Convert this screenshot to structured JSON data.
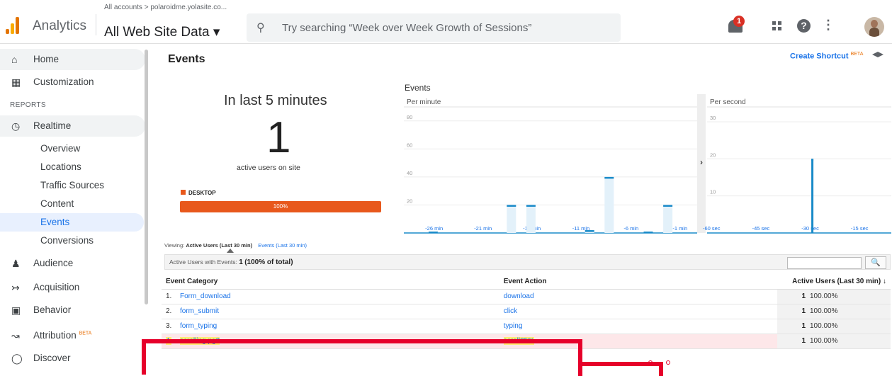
{
  "header": {
    "app_name": "Analytics",
    "breadcrumb": "All accounts > polaroidme.yolasite.co...",
    "property": "All Web Site Data ▾",
    "search_placeholder": "Try searching “Week over Week Growth of Sessions”",
    "notification_count": "1",
    "help": "?",
    "more": "⋮"
  },
  "sidebar": {
    "home": "Home",
    "customization": "Customization",
    "reports_heading": "REPORTS",
    "realtime": "Realtime",
    "realtime_items": [
      "Overview",
      "Locations",
      "Traffic Sources",
      "Content",
      "Events",
      "Conversions"
    ],
    "audience": "Audience",
    "acquisition": "Acquisition",
    "behavior": "Behavior",
    "attribution": "Attribution",
    "attribution_badge": "BETA",
    "discover": "Discover"
  },
  "page": {
    "title": "Events",
    "create_shortcut": "Create Shortcut",
    "shortcut_badge": "BETA"
  },
  "summary": {
    "headline": "In last 5 minutes",
    "active_users": "1",
    "active_label": "active users on site",
    "device": "DESKTOP",
    "device_share": "100%",
    "device_share_value": 100
  },
  "chart_data": {
    "type": "bar",
    "title": "Events",
    "panels": [
      {
        "label": "Per minute",
        "y_ticks": [
          "80",
          "60",
          "40",
          "20"
        ],
        "x_ticks": [
          "-26 min",
          "-21 min",
          "-16 min",
          "-11 min",
          "-6 min",
          "-1 min"
        ],
        "ylim": [
          0,
          90
        ],
        "x": [
          -29,
          -27,
          -25,
          -23,
          -21,
          -19,
          -17,
          -15,
          -13,
          -11,
          -9,
          -7,
          -5,
          -3,
          -1
        ],
        "values": [
          0,
          1,
          0,
          0,
          0,
          20,
          20,
          0,
          0,
          2,
          40,
          0,
          1,
          20,
          0
        ]
      },
      {
        "label": "Per second",
        "y_ticks": [
          "30",
          "20",
          "10"
        ],
        "x_ticks": [
          "-60 sec",
          "-45 sec",
          "-30 sec",
          "-15 sec"
        ],
        "ylim": [
          0,
          34
        ],
        "x": [
          -32
        ],
        "values": [
          20
        ]
      }
    ]
  },
  "viewing": {
    "label": "Viewing:",
    "active": "Active Users (Last 30 min)",
    "alt": "Events (Last 30 min)"
  },
  "table": {
    "summary_prefix": "Active Users with Events: ",
    "summary_count": "1",
    "summary_pct": "(100% of total)",
    "search_icon": "search-icon",
    "columns": [
      "Event Category",
      "Event Action",
      "Active Users (Last 30 min) ↓"
    ],
    "rows": [
      {
        "n": "1.",
        "category": "Form_download",
        "action": "download",
        "users": "1",
        "pct": "100.00%"
      },
      {
        "n": "2.",
        "category": "form_submit",
        "action": "click",
        "users": "1",
        "pct": "100.00%"
      },
      {
        "n": "3.",
        "category": "form_typing",
        "action": "typing",
        "users": "1",
        "pct": "100.00%"
      },
      {
        "n": "4.",
        "category": "scrolling pg2",
        "action": "scroll25%",
        "users": "1",
        "pct": "100.00%"
      }
    ]
  },
  "colors": {
    "accent": "#1a73e8",
    "desktop": "#e8581c",
    "bar": "#1a8bc9",
    "highlight": "#fff300",
    "annotation": "#e6002a"
  }
}
